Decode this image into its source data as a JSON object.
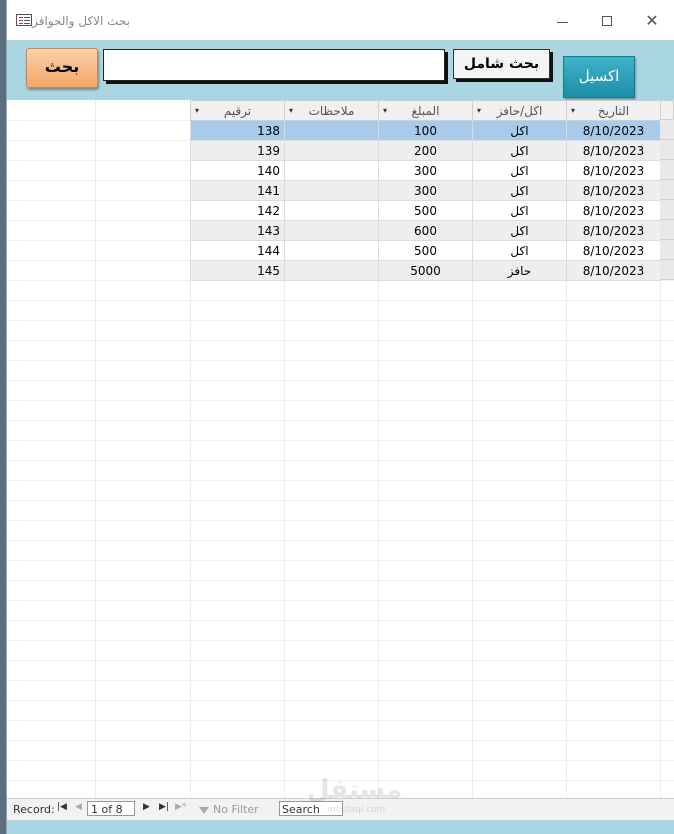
{
  "window": {
    "title": "بحث الاكل والحوافز",
    "icon": "form-icon"
  },
  "header": {
    "search_button": "بحث",
    "search_value": "",
    "global_search_button": "بحث شامل",
    "excel_button": "اكسيل",
    "colors": {
      "header_bg": "#a9d6e1",
      "search_btn": "#f3a769",
      "excel_btn": "#1c8ea6"
    }
  },
  "table": {
    "columns": [
      "ترقيم",
      "ملاحظات",
      "المبلغ",
      "اكل/حافز",
      "التاريخ"
    ],
    "rows": [
      {
        "num": "138",
        "notes": "",
        "amount": "100",
        "type": "اكل",
        "date": "8/10/2023"
      },
      {
        "num": "139",
        "notes": "",
        "amount": "200",
        "type": "اكل",
        "date": "8/10/2023"
      },
      {
        "num": "140",
        "notes": "",
        "amount": "300",
        "type": "اكل",
        "date": "8/10/2023"
      },
      {
        "num": "141",
        "notes": "",
        "amount": "300",
        "type": "اكل",
        "date": "8/10/2023"
      },
      {
        "num": "142",
        "notes": "",
        "amount": "500",
        "type": "اكل",
        "date": "8/10/2023"
      },
      {
        "num": "143",
        "notes": "",
        "amount": "600",
        "type": "اكل",
        "date": "8/10/2023"
      },
      {
        "num": "144",
        "notes": "",
        "amount": "500",
        "type": "اكل",
        "date": "8/10/2023"
      },
      {
        "num": "145",
        "notes": "",
        "amount": "5000",
        "type": "حافز",
        "date": "8/10/2023"
      }
    ],
    "selected_row": 0
  },
  "navbar": {
    "record_label": "Record:",
    "position": "1 of 8",
    "filter_label": "No Filter",
    "search_label": "Search"
  },
  "watermark": {
    "text": "مستقل",
    "sub": "mostaql.com"
  }
}
